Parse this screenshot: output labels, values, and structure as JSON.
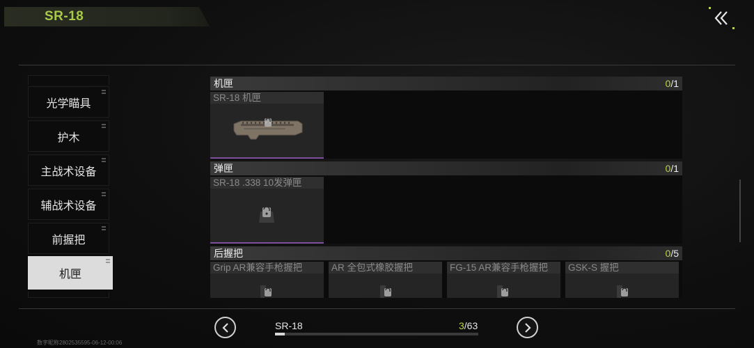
{
  "header": {
    "title": "SR-18"
  },
  "sidebar": {
    "items": [
      {
        "label": "光学瞄具",
        "active": false
      },
      {
        "label": "护木",
        "active": false
      },
      {
        "label": "主战术设备",
        "active": false
      },
      {
        "label": "辅战术设备",
        "active": false
      },
      {
        "label": "前握把",
        "active": false
      },
      {
        "label": "机匣",
        "active": true
      }
    ]
  },
  "sections": [
    {
      "title": "机匣",
      "count_current": "0",
      "count_total": "/1",
      "cards": [
        {
          "label": "SR-18 机匣",
          "icon": "receiver-part-icon"
        }
      ]
    },
    {
      "title": "弹匣",
      "count_current": "0",
      "count_total": "/1",
      "cards": [
        {
          "label": "SR-18 .338 10发弹匣",
          "icon": "magazine-part-icon"
        }
      ]
    },
    {
      "title": "后握把",
      "count_current": "0",
      "count_total": "/5",
      "cards": [
        {
          "label": "Grip AR兼容手枪握把",
          "icon": "grip-part-icon"
        },
        {
          "label": "AR 全包式橡胶握把",
          "icon": "grip-part-icon"
        },
        {
          "label": "FG-15 AR兼容手枪握把",
          "icon": "grip-part-icon"
        },
        {
          "label": "GSK-S 握把",
          "icon": "grip-part-icon"
        }
      ]
    }
  ],
  "footer": {
    "weapon_name": "SR-18",
    "page_current": "3",
    "page_total": "/63",
    "progress": 0.047,
    "watermark": "数字昵称2802535595-06-12-00:06"
  },
  "colors": {
    "accent": "#b8d44a",
    "rarity_bar": "#7c4fa0",
    "active_tab": "#dcdcdc"
  }
}
